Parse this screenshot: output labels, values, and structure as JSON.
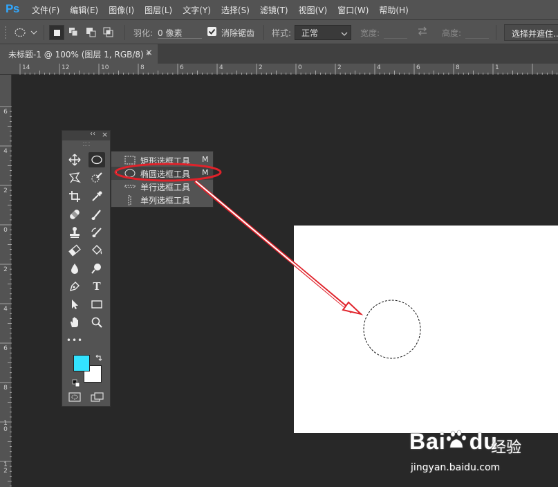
{
  "app": {
    "logo": "Ps"
  },
  "menu": [
    "文件(F)",
    "编辑(E)",
    "图像(I)",
    "图层(L)",
    "文字(Y)",
    "选择(S)",
    "滤镜(T)",
    "视图(V)",
    "窗口(W)",
    "帮助(H)"
  ],
  "options_bar": {
    "feather_label": "羽化:",
    "feather_value": "0 像素",
    "antialias_label": "消除锯齿",
    "antialias_checked": true,
    "style_label": "样式:",
    "style_value": "正常",
    "width_label": "宽度:",
    "height_label": "高度:",
    "select_and_mask": "选择并遮住..."
  },
  "document_tab": {
    "title": "未标题-1 @ 100% (图层 1, RGB/8) *",
    "close": "×"
  },
  "ruler_top": [
    "14",
    "12",
    "10",
    "8",
    "6",
    "4",
    "2",
    "0",
    "2",
    "4",
    "6",
    "8",
    "1"
  ],
  "ruler_left": [
    "6",
    "4",
    "2",
    "0",
    "2",
    "4",
    "6",
    "8",
    "10",
    "12"
  ],
  "tools_panel": {
    "collapse": "‹‹",
    "close": "×",
    "foreground_color": "#33e3ff",
    "background_color": "#ffffff",
    "more_tools": "•••"
  },
  "marquee_flyout": [
    {
      "icon": "rectangular-marquee-icon",
      "label": "矩形选框工具",
      "shortcut": "M",
      "selected": false
    },
    {
      "icon": "elliptical-marquee-icon",
      "label": "椭圆选框工具",
      "shortcut": "M",
      "selected": true
    },
    {
      "icon": "single-row-marquee-icon",
      "label": "单行选框工具",
      "shortcut": "",
      "selected": false
    },
    {
      "icon": "single-column-marquee-icon",
      "label": "单列选框工具",
      "shortcut": "",
      "selected": false
    }
  ],
  "colors": {
    "highlight_ellipse": "#e0222a",
    "arrow": "#e0222a",
    "canvas": "#ffffff",
    "ps_blue": "#31a8ff"
  },
  "watermark": {
    "brand": "Bai",
    "brand_suffix": "du",
    "cn": "经验",
    "url": "jingyan.baidu.com"
  }
}
